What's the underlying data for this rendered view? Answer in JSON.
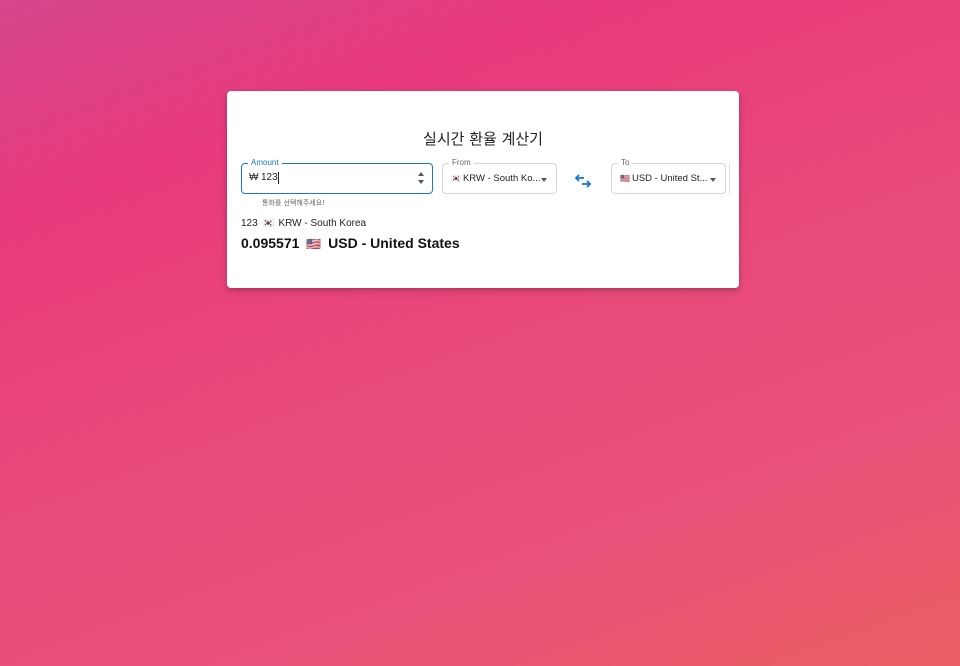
{
  "title": "실시간 환율 계산기",
  "amount": {
    "label": "Amount",
    "prefix": "₩",
    "value": "123",
    "helper": "통화를 선택해주세요!"
  },
  "from": {
    "label": "From",
    "flag": "🇰🇷",
    "value": "KRW - South Ko..."
  },
  "to": {
    "label": "To",
    "flag": "🇺🇸",
    "value": "USD - United St..."
  },
  "swap_icon": "swap-arrows-icon",
  "source": {
    "amount": "123",
    "flag": "🇰🇷",
    "currency": "KRW - South Korea"
  },
  "result": {
    "amount": "0.095571",
    "flag": "🇺🇸",
    "currency": "USD - United States"
  },
  "colors": {
    "accent": "#1976d2"
  }
}
